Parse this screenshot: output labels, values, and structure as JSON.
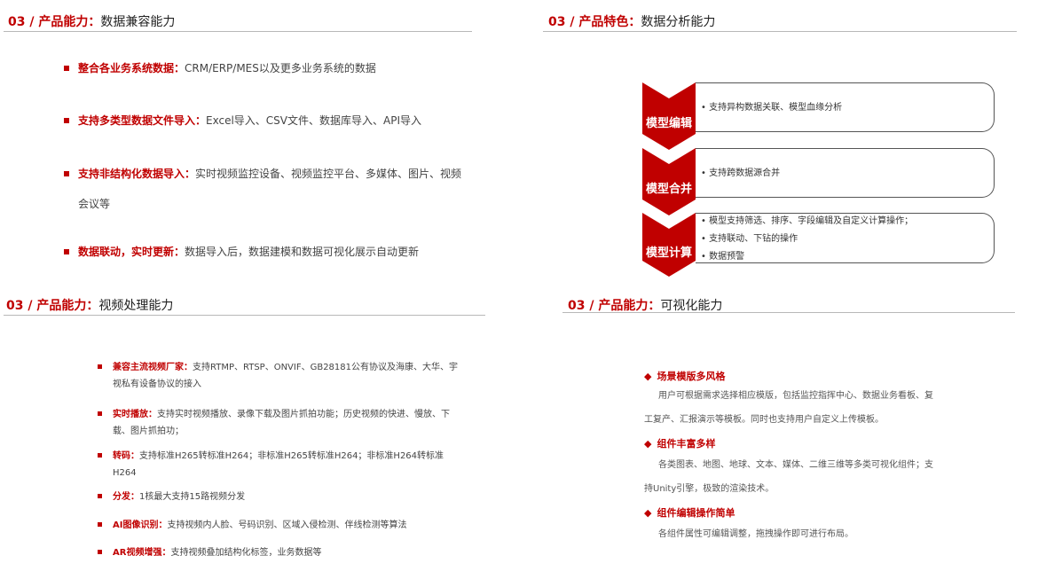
{
  "panels": {
    "data_compat": {
      "title_prefix": "03 / 产品能力：",
      "title_main": "数据兼容能力",
      "items": [
        {
          "key": "整合各业务系统数据：",
          "text": "CRM/ERP/MES以及更多业务系统的数据"
        },
        {
          "key": "支持多类型数据文件导入：",
          "text": "Excel导入、CSV文件、数据库导入、API导入"
        },
        {
          "key": "支持非结构化数据导入：",
          "text": "实时视频监控设备、视频监控平台、多媒体、图片、视频会议等"
        },
        {
          "key": "数据联动，实时更新：",
          "text": "数据导入后，数据建模和数据可视化展示自动更新"
        }
      ]
    },
    "data_analysis": {
      "title_prefix": "03 / 产品特色：",
      "title_main": "数据分析能力",
      "steps": [
        {
          "label": "模型编辑",
          "lines": [
            "• 支持异构数据关联、模型血缘分析"
          ]
        },
        {
          "label": "模型合并",
          "lines": [
            "• 支持跨数据源合并"
          ]
        },
        {
          "label": "模型计算",
          "lines": [
            "• 模型支持筛选、排序、字段编辑及自定义计算操作；",
            "• 支持联动、下钻的操作",
            "• 数据预警"
          ]
        }
      ]
    },
    "video": {
      "title_prefix": "03 / 产品能力：",
      "title_main": "视频处理能力",
      "items": [
        {
          "key": "兼容主流视频厂家：",
          "text": "支持RTMP、RTSP、ONVIF、GB28181公有协议及海康、大华、宇视私有设备协议的接入"
        },
        {
          "key": "实时播放：",
          "text": "支持实时视频播放、录像下载及图片抓拍功能；历史视频的快进、慢放、下载、图片抓拍功；"
        },
        {
          "key": "转码：",
          "text": "支持标准H265转标准H264；非标准H265转标准H264；非标准H264转标准H264"
        },
        {
          "key": "分发：",
          "text": "1核最大支持15路视频分发"
        },
        {
          "key": "AI图像识别：",
          "text": "支持视频内人脸、号码识别、区域入侵检测、伴线检测等算法"
        },
        {
          "key": "AR视频增强：",
          "text": "支持视频叠加结构化标签，业务数据等"
        }
      ]
    },
    "visual": {
      "title_prefix": "03 / 产品能力：",
      "title_main": "可视化能力",
      "sections": [
        {
          "heading": "场景模版多风格",
          "body": "用户可根据需求选择相应模版，包括监控指挥中心、数据业务看板、复工复产、汇报演示等模板。同时也支持用户自定义上传模板。"
        },
        {
          "heading": "组件丰富多样",
          "body": "各类图表、地图、地球、文本、媒体、二维三维等多类可视化组件；支持Unity引擎，极致的渲染技术。"
        },
        {
          "heading": "组件编辑操作简单",
          "body": "各组件属性可编辑调整，拖拽操作即可进行布局。"
        }
      ],
      "diamond": "◆"
    }
  }
}
